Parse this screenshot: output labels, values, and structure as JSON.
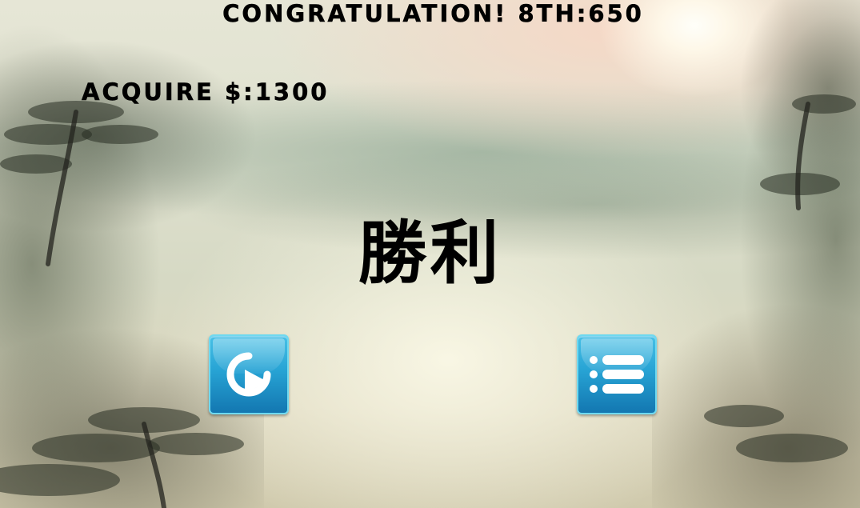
{
  "hud": {
    "congratulation": "CONGRATULATION! 8TH:650",
    "acquire": "ACQUIRE $:1300"
  },
  "result": {
    "victory_label": "勝利"
  },
  "buttons": {
    "restart_icon": "restart-play-icon",
    "menu_icon": "list-menu-icon"
  },
  "colors": {
    "button_top": "#48c0e6",
    "button_bottom": "#1377b1",
    "button_border": "#6fd9f0",
    "text": "#000000"
  }
}
